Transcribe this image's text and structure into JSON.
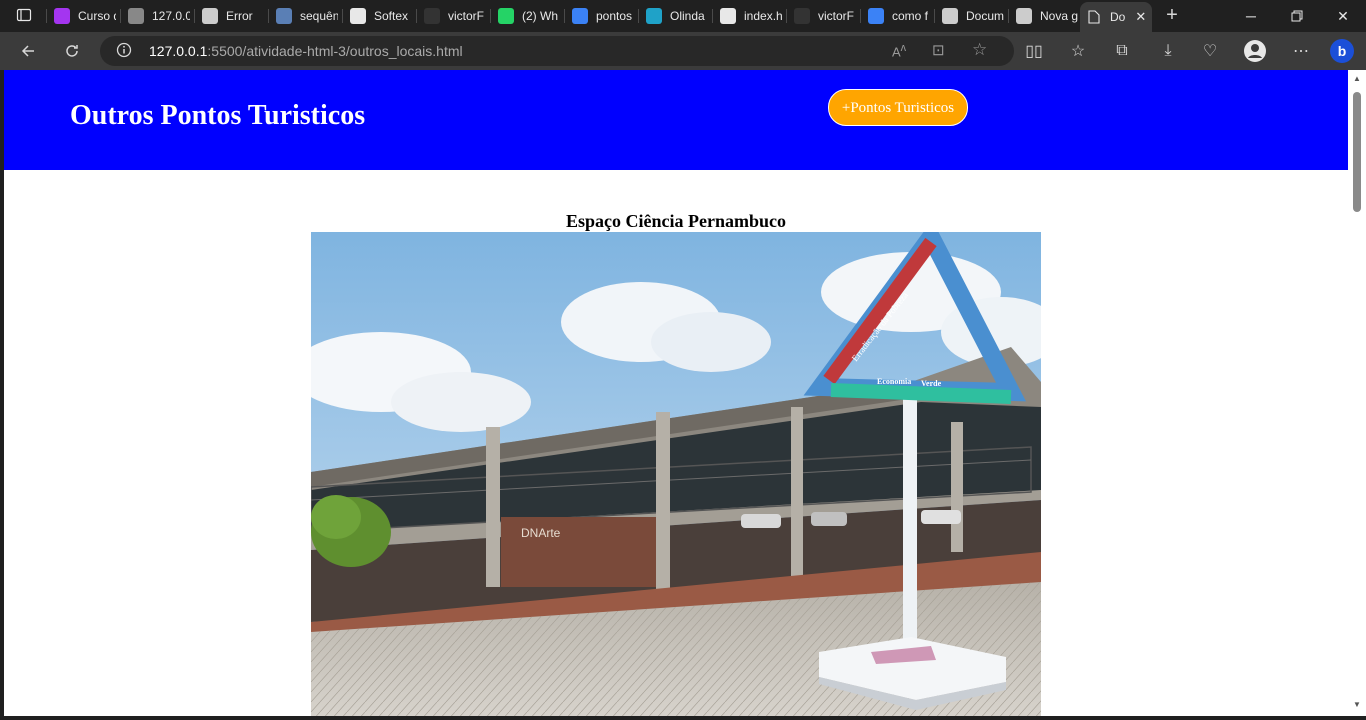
{
  "browser": {
    "tabs": [
      {
        "label": "Curso d",
        "icon": "udemy-icon",
        "color": "#a435f0"
      },
      {
        "label": "127.0.0",
        "icon": "page-icon",
        "color": "#888888"
      },
      {
        "label": "Error",
        "icon": "document-icon",
        "color": "#cccccc"
      },
      {
        "label": "sequên",
        "icon": "script-icon",
        "color": "#5a7fb5"
      },
      {
        "label": "Softex",
        "icon": "softex-icon",
        "color": "#e8e8e8"
      },
      {
        "label": "victorF",
        "icon": "github-icon",
        "color": "#333333"
      },
      {
        "label": "(2) Wh",
        "icon": "whatsapp-icon",
        "color": "#25d366"
      },
      {
        "label": "pontos",
        "icon": "search-icon",
        "color": "#3b82f6"
      },
      {
        "label": "Olinda",
        "icon": "check-icon",
        "color": "#1fa2c8"
      },
      {
        "label": "index.h",
        "icon": "github-icon",
        "color": "#e8e8e8"
      },
      {
        "label": "victorF",
        "icon": "github-icon",
        "color": "#333333"
      },
      {
        "label": "como f",
        "icon": "search-icon",
        "color": "#3b82f6"
      },
      {
        "label": "Docum",
        "icon": "document-icon",
        "color": "#cccccc"
      },
      {
        "label": "Nova g",
        "icon": "newtab-icon",
        "color": "#cccccc"
      }
    ],
    "active_tab": {
      "label": "Do",
      "icon": "document-icon"
    },
    "address": {
      "host": "127.0.0.1",
      "path": ":5500/atividade-html-3/outros_locais.html"
    }
  },
  "page": {
    "header_title": "Outros Pontos Turisticos",
    "button_label": "+Pontos Turisticos",
    "place_title": "Espaço Ciência Pernambuco",
    "triangle_labels": [
      "Erradicação da Pobreza",
      "Economia",
      "Verde"
    ],
    "building_sign": "DNArte",
    "colors": {
      "header": "#0000ff",
      "button": "#ffa500",
      "text_on_header": "#ffffff"
    }
  }
}
